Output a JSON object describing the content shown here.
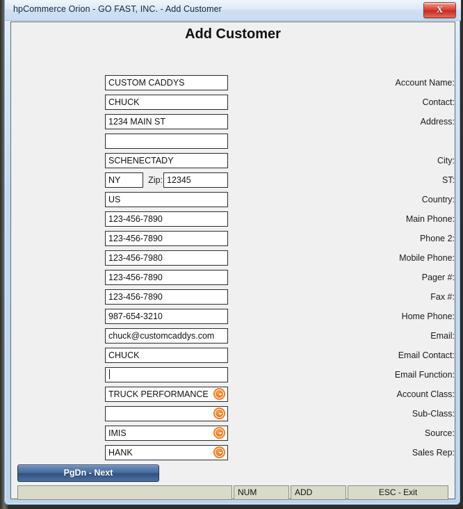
{
  "window": {
    "title": "hpCommerce Orion - GO FAST, INC. - Add Customer",
    "close_glyph": "X"
  },
  "form": {
    "heading": "Add Customer",
    "fields": [
      {
        "label": "Account Name:",
        "value": "CUSTOM CADDYS",
        "type": "text",
        "name": "account-name"
      },
      {
        "label": "Contact:",
        "value": "CHUCK",
        "type": "text",
        "name": "contact"
      },
      {
        "label": "Address:",
        "value": "1234 MAIN ST",
        "type": "text",
        "name": "address-line-1"
      },
      {
        "label": "",
        "value": "",
        "type": "text",
        "name": "address-line-2"
      },
      {
        "label": "City:",
        "value": "SCHENECTADY",
        "type": "text",
        "name": "city"
      },
      {
        "label": "ST:",
        "value": "NY",
        "type": "text",
        "name": "state"
      },
      {
        "label": "Zip:",
        "value": "12345",
        "type": "text",
        "name": "zip"
      },
      {
        "label": "Country:",
        "value": "US",
        "type": "text",
        "name": "country"
      },
      {
        "label": "Main Phone:",
        "value": "123-456-7890",
        "type": "text",
        "name": "main-phone"
      },
      {
        "label": "Phone 2:",
        "value": "123-456-7890",
        "type": "text",
        "name": "phone-2"
      },
      {
        "label": "Mobile Phone:",
        "value": "123-456-7980",
        "type": "text",
        "name": "mobile-phone"
      },
      {
        "label": "Pager #:",
        "value": "123-456-7890",
        "type": "text",
        "name": "pager"
      },
      {
        "label": "Fax #:",
        "value": "123-456-7890",
        "type": "text",
        "name": "fax"
      },
      {
        "label": "Home Phone:",
        "value": "987-654-3210",
        "type": "text",
        "name": "home-phone"
      },
      {
        "label": "Email:",
        "value": "chuck@customcaddys.com",
        "type": "text",
        "name": "email"
      },
      {
        "label": "Email Contact:",
        "value": "CHUCK",
        "type": "text",
        "name": "email-contact"
      },
      {
        "label": "Email Function:",
        "value": "",
        "type": "text-focused",
        "name": "email-function"
      },
      {
        "label": "Account Class:",
        "value": "TRUCK PERFORMANCE",
        "type": "combo",
        "name": "account-class"
      },
      {
        "label": "Sub-Class:",
        "value": "",
        "type": "combo",
        "name": "sub-class"
      },
      {
        "label": "Source:",
        "value": "IMIS",
        "type": "combo",
        "name": "source"
      },
      {
        "label": "Sales Rep:",
        "value": "HANK",
        "type": "combo",
        "name": "sales-rep"
      }
    ]
  },
  "actions": {
    "pgdn_next": "PgDn - Next"
  },
  "status_bar": {
    "message": "",
    "num": "NUM",
    "mode": "ADD",
    "esc": "ESC - Exit"
  },
  "colors": {
    "accent_orange": "#f47b20",
    "button_blue": "#2f527f",
    "status_bg": "#d7dbc8",
    "close_red": "#d6372a"
  }
}
